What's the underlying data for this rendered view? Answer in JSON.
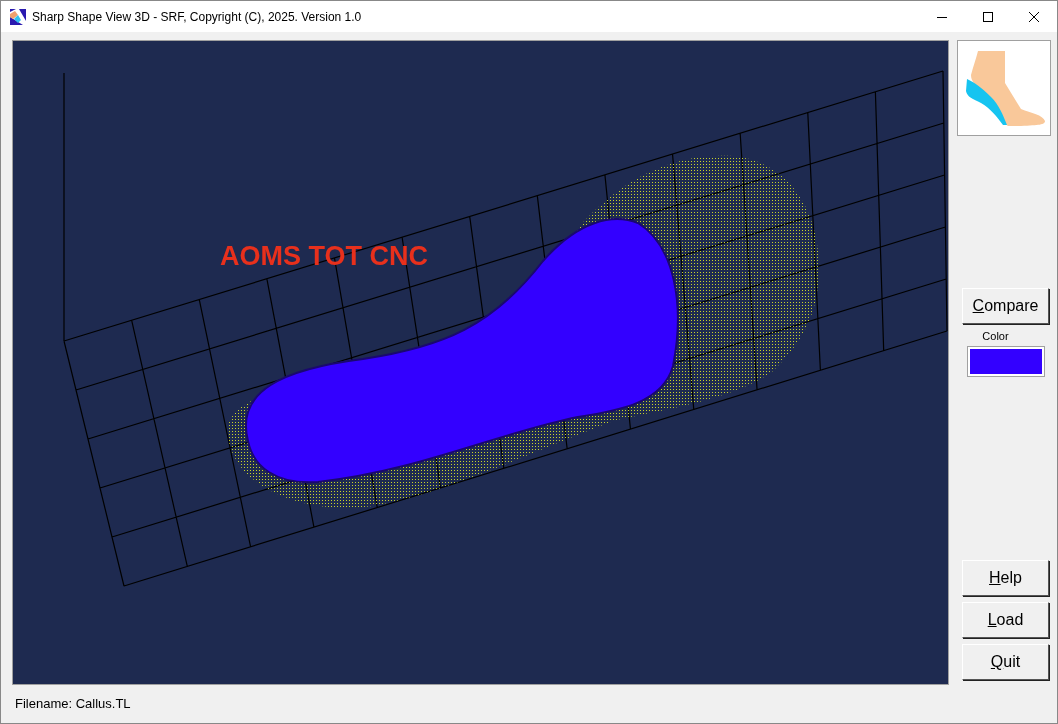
{
  "window": {
    "title": "Sharp Shape View 3D - SRF, Copyright (C), 2025. Version 1.0"
  },
  "viewport": {
    "overlay_text": "AOMS TOT CNC"
  },
  "side_panel": {
    "compare_button": {
      "label": "Compare",
      "mnemonic_underlined": true
    },
    "color_label": "Color",
    "color": "#3300ff",
    "buttons": [
      {
        "label": "Help",
        "mnemonic_underlined": true
      },
      {
        "label": "Load",
        "mnemonic_underlined": true
      },
      {
        "label": "Quit",
        "mnemonic_underlined": true
      }
    ]
  },
  "status_bar": {
    "text": "Filename: Callus.TL"
  }
}
